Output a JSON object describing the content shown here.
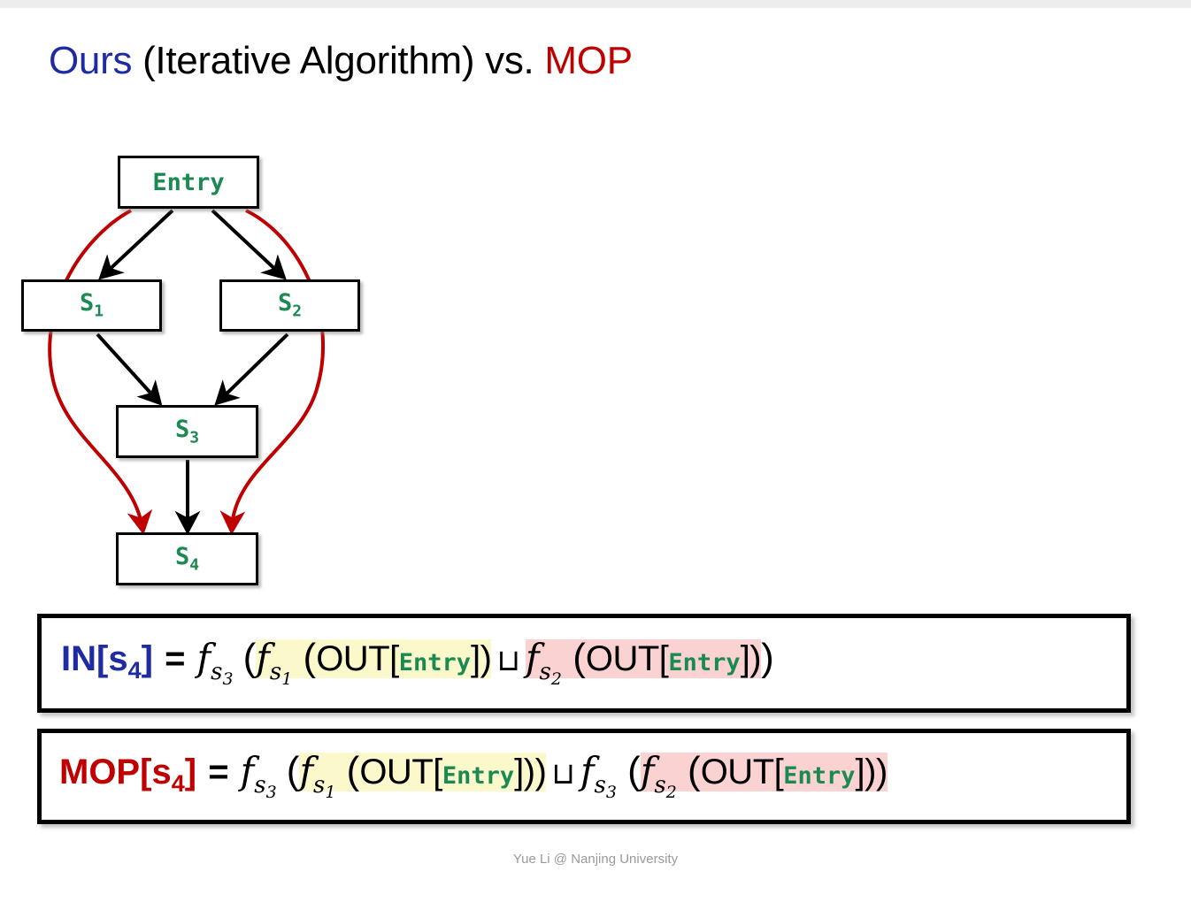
{
  "slide": {
    "title_parts": {
      "ours": "Ours",
      "middle": " (Iterative Algorithm) vs. ",
      "mop": "MOP"
    },
    "title_full": "Ours (Iterative Algorithm) vs. MOP",
    "footer": "Yue Li @ Nanjing University"
  },
  "colors": {
    "ours_blue": "#1F2BA0",
    "mop_red": "#C00000",
    "node_green": "#1B8A52",
    "highlight_yellow": "#FBF8CC",
    "highlight_pink": "#FAD2D2",
    "edge_black": "#000000",
    "edge_red": "#C00000"
  },
  "cfg": {
    "nodes": [
      {
        "id": "entry",
        "label": "Entry",
        "sub": ""
      },
      {
        "id": "s1",
        "label": "S",
        "sub": "1"
      },
      {
        "id": "s2",
        "label": "S",
        "sub": "2"
      },
      {
        "id": "s3",
        "label": "S",
        "sub": "3"
      },
      {
        "id": "s4",
        "label": "S",
        "sub": "4"
      }
    ],
    "black_edges": [
      "Entry->S1",
      "Entry->S2",
      "S1->S3",
      "S2->S3",
      "S3->S4"
    ],
    "red_paths": [
      "Entry->(around S1)->S4",
      "Entry->(around S2)->S4"
    ]
  },
  "equations": {
    "in": {
      "lhs_name": "IN",
      "lhs_sub": "4",
      "lhs_bracket_open": "[s",
      "lhs_bracket_close": "]",
      "equals": "=",
      "f_letter": "f",
      "f3_sub_s": "s",
      "f3_sub_n": "3",
      "open_paren": "(",
      "f1_sub_s": "s",
      "f1_sub_n": "1",
      "out": "OUT[",
      "entry": "Entry",
      "out_close": "])",
      "join": "⊔",
      "f2_sub_s": "s",
      "f2_sub_n": "2",
      "out2": "OUT[",
      "entry2": "Entry",
      "out2_close": "])",
      "final_close": ")",
      "plain": "IN[s4] = f_s3 (f_s1 (OUT[Entry]) ⊔ f_s2 (OUT[Entry]))"
    },
    "mop": {
      "lhs_name": "MOP",
      "lhs_sub": "4",
      "lhs_bracket_open": "[s",
      "lhs_bracket_close": "]",
      "equals": "=",
      "f_letter": "f",
      "f3a_sub_s": "s",
      "f3a_sub_n": "3",
      "open_paren": "(",
      "f1_sub_s": "s",
      "f1_sub_n": "1",
      "out": "OUT[",
      "entry": "Entry",
      "out_close": "]))",
      "join": "⊔",
      "f3b_sub_s": "s",
      "f3b_sub_n": "3",
      "open_paren2": "(",
      "f2_sub_s": "s",
      "f2_sub_n": "2",
      "out2": "OUT[",
      "entry2": "Entry",
      "out2_close": "]))",
      "plain": "MOP[s4] = f_s3 (f_s1 (OUT[Entry])) ⊔ f_s3 (f_s2 (OUT[Entry]))"
    }
  }
}
